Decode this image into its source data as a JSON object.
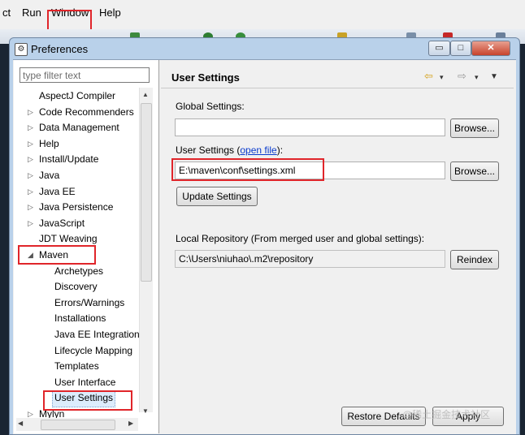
{
  "menubar": {
    "items": [
      "ct",
      "Run",
      "Window",
      "Help"
    ]
  },
  "dialog": {
    "title": "Preferences",
    "window_buttons": {
      "minimize": "▭",
      "maximize": "□",
      "close": "✕"
    }
  },
  "sidebar": {
    "filter_placeholder": "type filter text",
    "items": [
      {
        "label": "AspectJ Compiler",
        "expandable": false
      },
      {
        "label": "Code Recommenders",
        "expandable": true
      },
      {
        "label": "Data Management",
        "expandable": true
      },
      {
        "label": "Help",
        "expandable": true
      },
      {
        "label": "Install/Update",
        "expandable": true
      },
      {
        "label": "Java",
        "expandable": true
      },
      {
        "label": "Java EE",
        "expandable": true
      },
      {
        "label": "Java Persistence",
        "expandable": true
      },
      {
        "label": "JavaScript",
        "expandable": true
      },
      {
        "label": "JDT Weaving",
        "expandable": false
      },
      {
        "label": "Maven",
        "expanded": true
      },
      {
        "label": "Archetypes"
      },
      {
        "label": "Discovery"
      },
      {
        "label": "Errors/Warnings"
      },
      {
        "label": "Installations"
      },
      {
        "label": "Java EE Integration"
      },
      {
        "label": "Lifecycle Mapping"
      },
      {
        "label": "Templates"
      },
      {
        "label": "User Interface"
      },
      {
        "label": "User Settings",
        "selected": true
      },
      {
        "label": "Mylyn",
        "expandable": true
      }
    ]
  },
  "main": {
    "title": "User Settings",
    "global_settings_label": "Global Settings:",
    "global_settings_value": "",
    "browse_label": "Browse...",
    "user_settings_label": "User Settings (",
    "open_file_link": "open file",
    "user_settings_label_end": "):",
    "user_settings_value": "E:\\maven\\conf\\settings.xml",
    "update_settings_label": "Update Settings",
    "local_repo_label": "Local Repository (From merged user and global settings):",
    "local_repo_value": "C:\\Users\\niuhao\\.m2\\repository",
    "reindex_label": "Reindex",
    "restore_defaults_label": "Restore Defaults",
    "apply_label": "Apply"
  },
  "watermark": "@稀土掘金技术社区",
  "colors": {
    "highlight": "#e0252a",
    "link": "#0a3bcd"
  }
}
